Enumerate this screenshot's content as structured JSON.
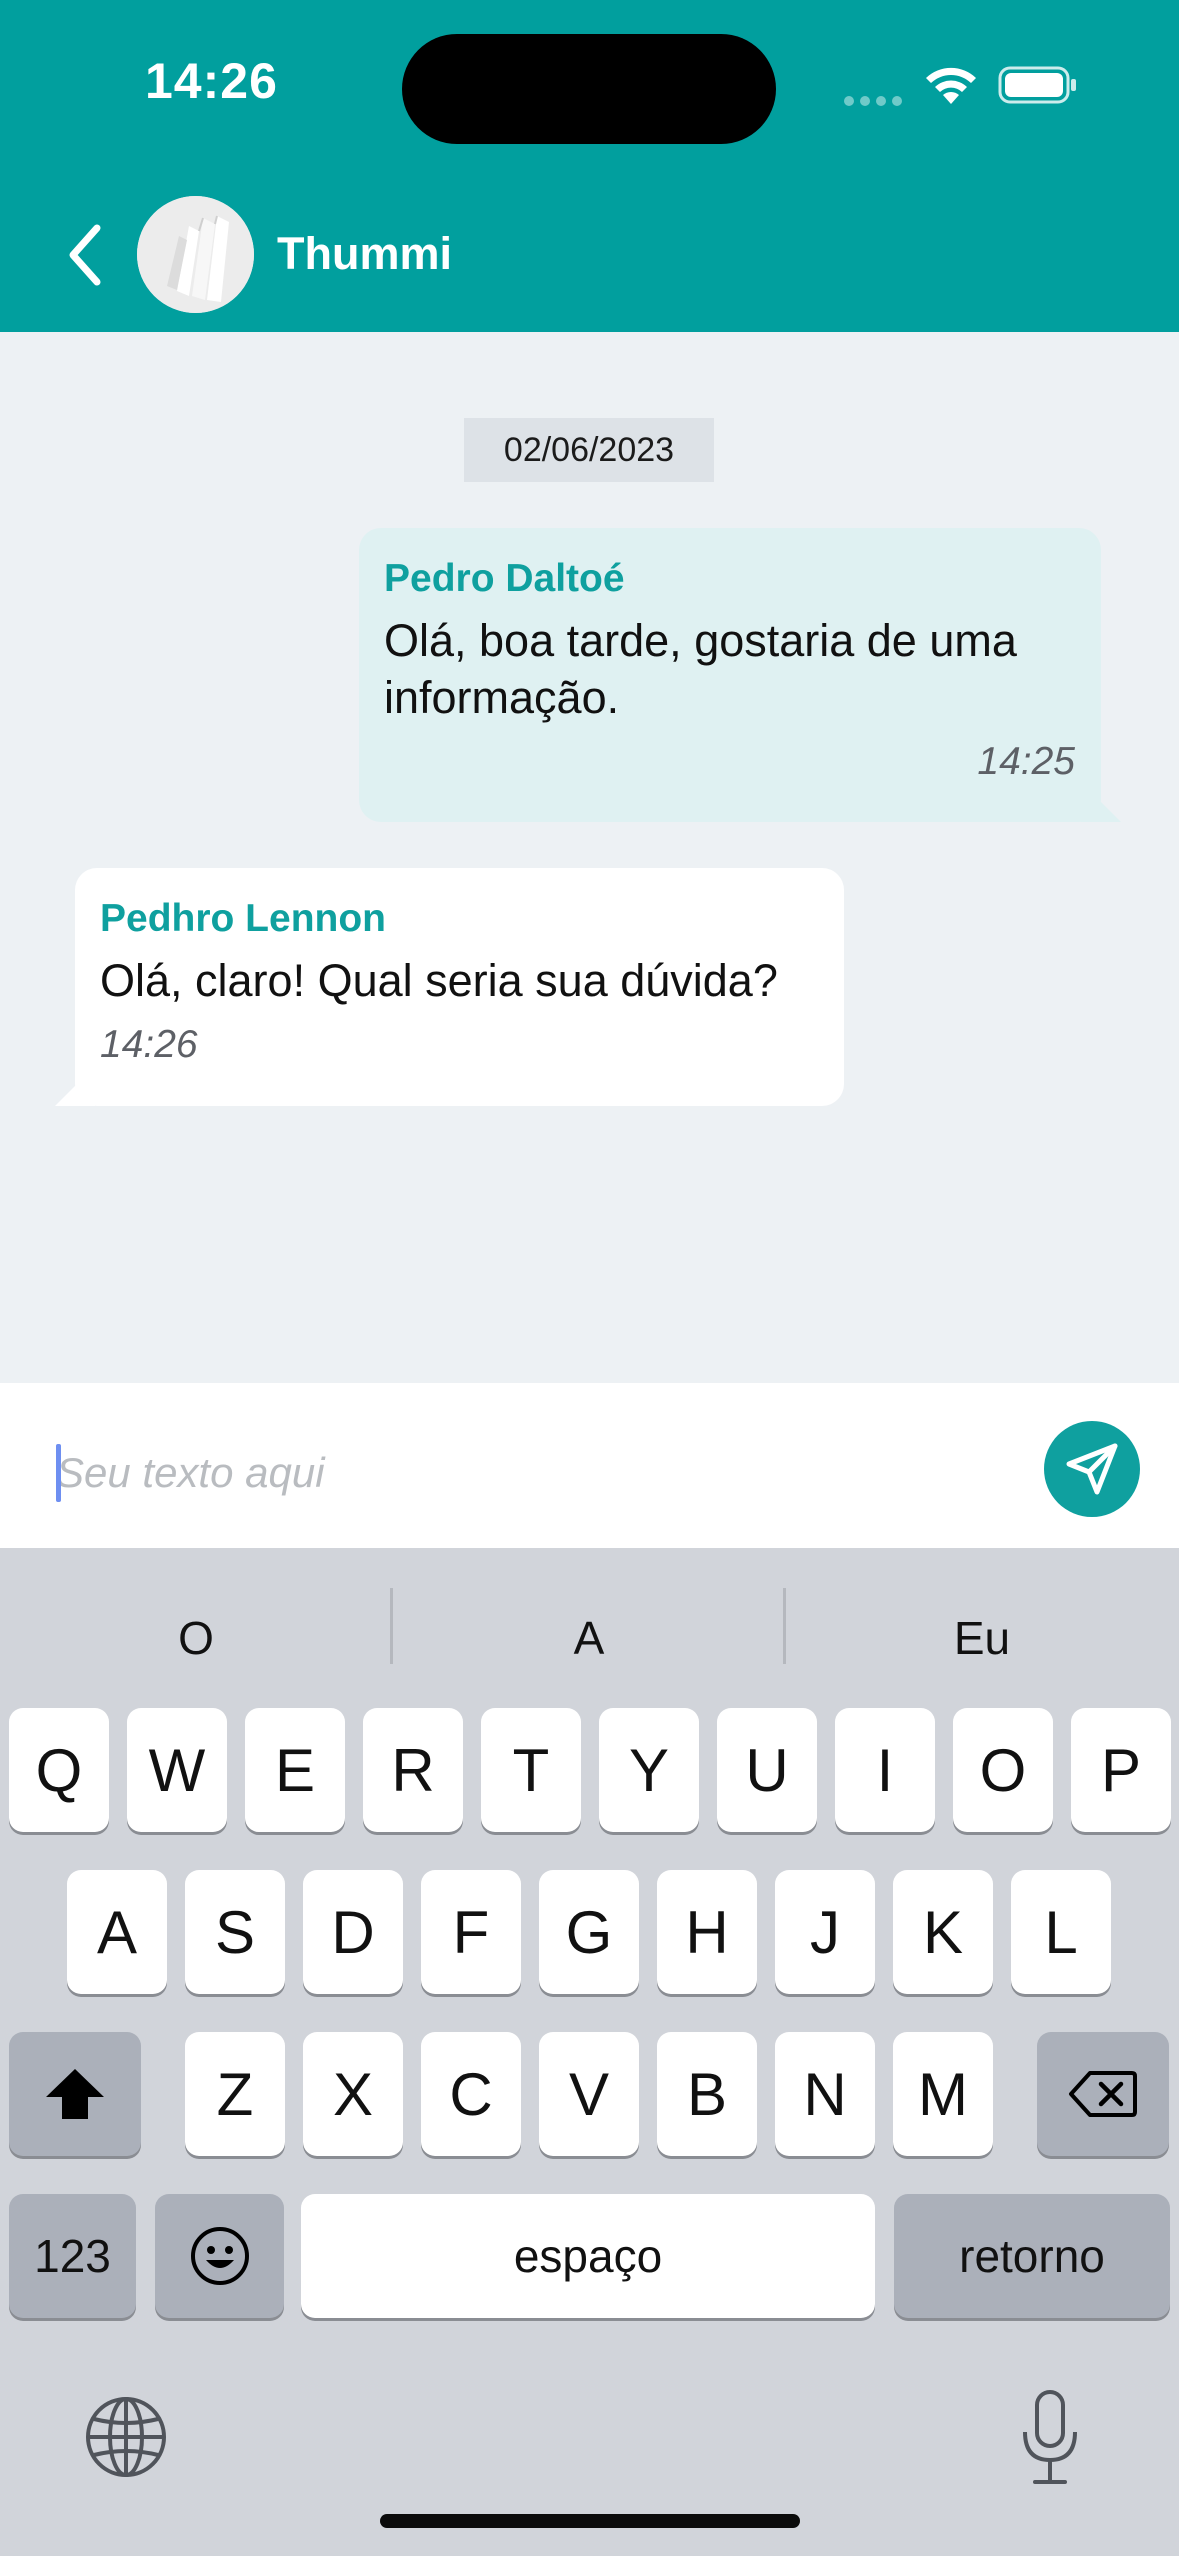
{
  "status_bar": {
    "time": "14:26"
  },
  "header": {
    "contact_name": "Thummi"
  },
  "chat": {
    "date": "02/06/2023",
    "messages": [
      {
        "sender": "Pedro Daltoé",
        "text": "Olá, boa tarde, gostaria de uma informação.",
        "time": "14:25",
        "direction": "sent"
      },
      {
        "sender": "Pedhro Lennon",
        "text": "Olá, claro! Qual seria sua dúvida?",
        "time": "14:26",
        "direction": "received"
      }
    ]
  },
  "composer": {
    "placeholder": "Seu texto aqui",
    "value": ""
  },
  "keyboard": {
    "suggestions": [
      "O",
      "A",
      "Eu"
    ],
    "row1": [
      "Q",
      "W",
      "E",
      "R",
      "T",
      "Y",
      "U",
      "I",
      "O",
      "P"
    ],
    "row2": [
      "A",
      "S",
      "D",
      "F",
      "G",
      "H",
      "J",
      "K",
      "L"
    ],
    "row3": [
      "Z",
      "X",
      "C",
      "V",
      "B",
      "N",
      "M"
    ],
    "numbers_label": "123",
    "space_label": "espaço",
    "return_label": "retorno"
  },
  "colors": {
    "accent": "#019f9e",
    "sent_bubble": "#dff1f2",
    "chat_background": "#edf1f4",
    "keyboard": "#d1d4da"
  }
}
